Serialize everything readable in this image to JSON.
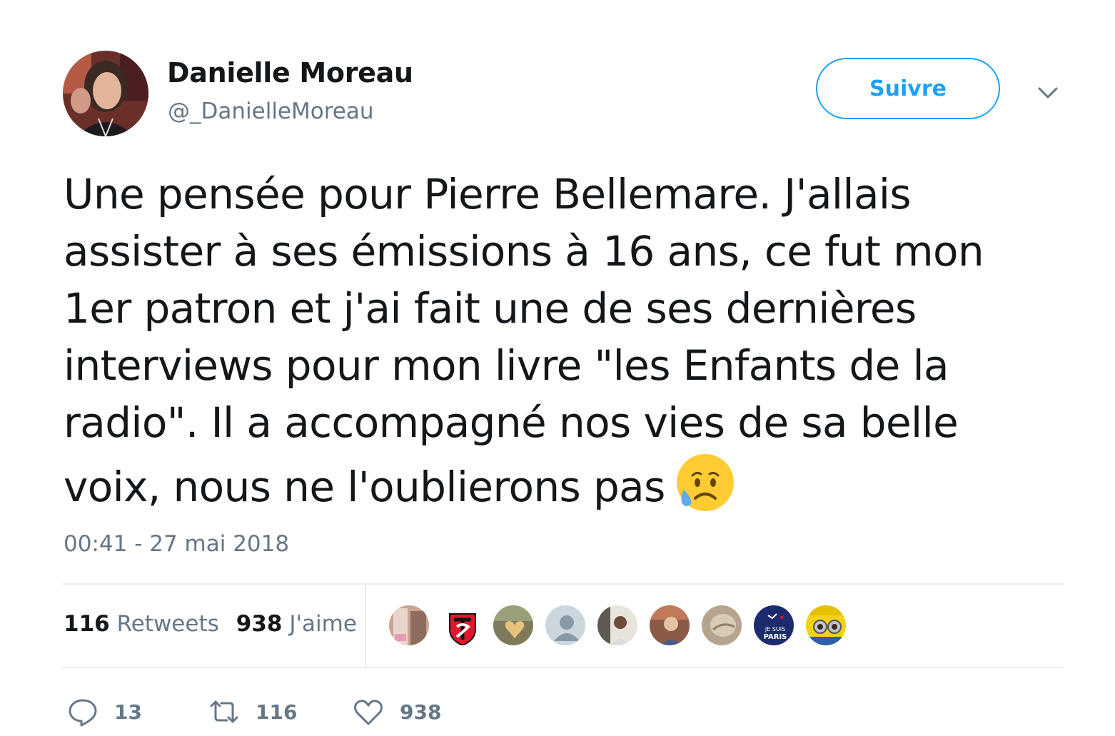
{
  "author": {
    "display_name": "Danielle Moreau",
    "handle": "@_DanielleMoreau"
  },
  "follow_label": "Suivre",
  "tweet": {
    "lines": [
      "Une pensée pour Pierre Bellemare. J'allais",
      "assister à ses émissions à 16 ans, ce fut mon",
      "1er patron et j'ai fait une de ses dernières",
      "interviews pour mon livre \"les Enfants de la",
      "radio\". Il a accompagné nos vies de sa belle",
      "voix, nous ne l'oublierons pas"
    ],
    "emoji": "sad-but-relieved-face",
    "timestamp": "00:41 - 27 mai 2018"
  },
  "stats": {
    "retweets_count": "116",
    "retweets_label": "Retweets",
    "likes_count": "938",
    "likes_label": "J'aime"
  },
  "liker_avatars": [
    {
      "icon": "photo-avatar",
      "color": "#caa58f"
    },
    {
      "icon": "stade-toulousain-logo",
      "color": "#e4162c"
    },
    {
      "icon": "heart-photo-avatar",
      "color": "#7e7a5c"
    },
    {
      "icon": "default-user-avatar",
      "color": "#aab8c2"
    },
    {
      "icon": "photo-avatar",
      "color": "#5e5a52"
    },
    {
      "icon": "photo-avatar",
      "color": "#8b5a48"
    },
    {
      "icon": "photo-avatar",
      "color": "#b5a58f"
    },
    {
      "icon": "psg-je-suis-paris-logo",
      "color": "#1c2a6e",
      "text_top": "JE SUIS",
      "text_bottom": "PARIS"
    },
    {
      "icon": "minions-avatar",
      "color": "#f3d21b"
    }
  ],
  "actions": {
    "reply_count": "13",
    "retweet_count": "116",
    "like_count": "938"
  },
  "colors": {
    "accent": "#1da1f2",
    "text": "#14171a",
    "secondary": "#657786",
    "divider": "#e6ecf0"
  }
}
